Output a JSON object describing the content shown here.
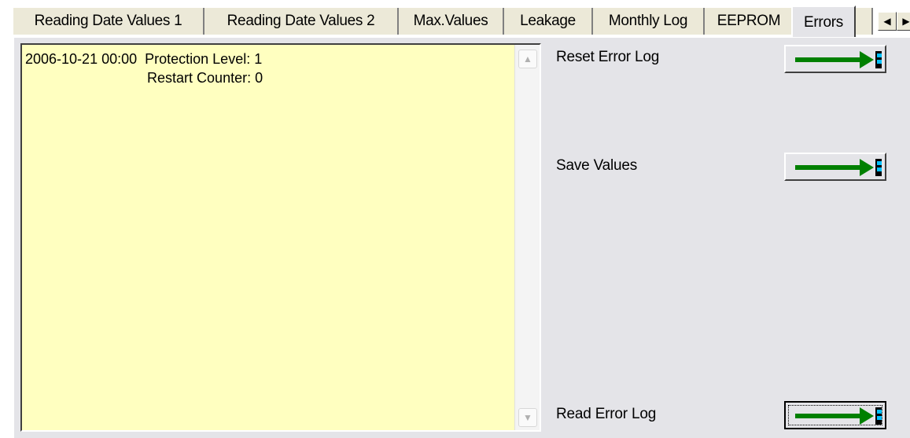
{
  "tabs": [
    "Reading Date Values 1",
    "Reading Date Values 2",
    "Max.Values",
    "Leakage",
    "Monthly Log",
    "EEPROM",
    "Errors"
  ],
  "active_tab": "Errors",
  "log": {
    "line1": "2006-10-21 00:00  Protection Level: 1",
    "line2": "                               Restart Counter: 0"
  },
  "actions": {
    "reset_label": "Reset Error Log",
    "save_label": "Save Values",
    "read_label": "Read Error Log"
  },
  "colors": {
    "log_bg": "#ffffc0",
    "arrow": "#008000",
    "panel": "#e4e4e8"
  },
  "icons": [
    "scroll-left-icon",
    "scroll-right-icon",
    "scroll-up-icon",
    "scroll-down-icon",
    "arrow-to-device-icon"
  ]
}
